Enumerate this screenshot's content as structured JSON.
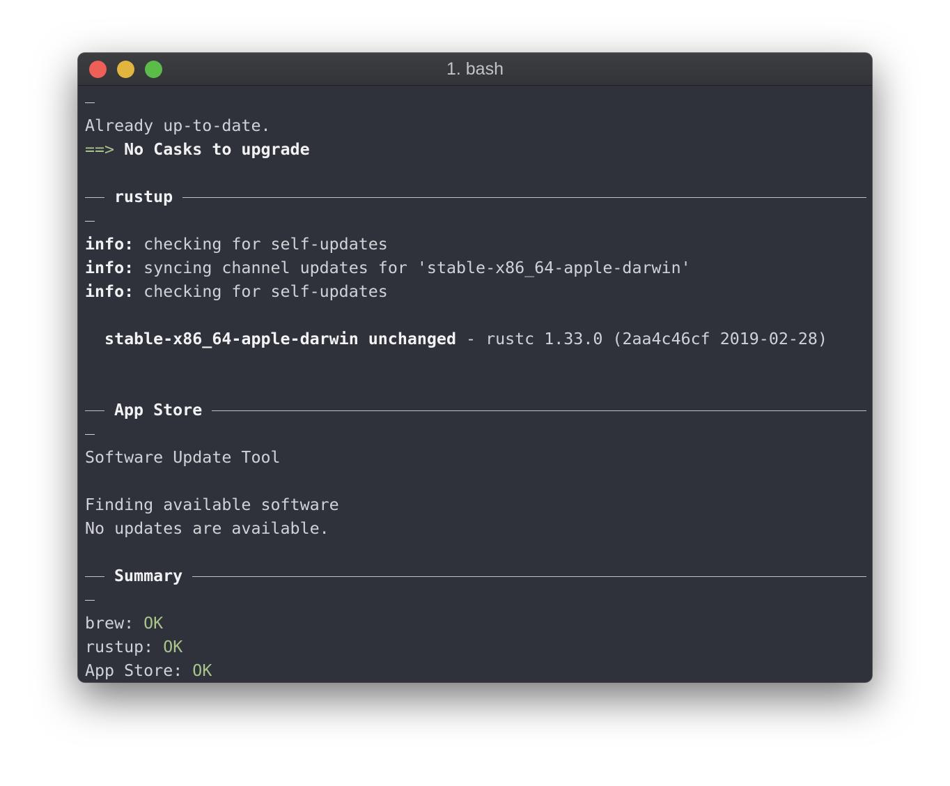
{
  "window": {
    "title": "1. bash"
  },
  "terminal": {
    "brew_tail": {
      "already": "Already up-to-date.",
      "arrow": "==>",
      "no_casks": "No Casks to upgrade"
    },
    "rustup": {
      "header": "rustup",
      "info_label": "info:",
      "info1": " checking for self-updates",
      "info2": " syncing channel updates for 'stable-x86_64-apple-darwin'",
      "info3": " checking for self-updates",
      "toolchain": "  stable-x86_64-apple-darwin unchanged",
      "toolchain_rest": " - rustc 1.33.0 (2aa4c46cf 2019-02-28)"
    },
    "appstore": {
      "header": "App Store",
      "tool": "Software Update Tool",
      "finding": "Finding available software",
      "no_updates": "No updates are available."
    },
    "summary": {
      "header": "Summary",
      "brew_label": "brew: ",
      "brew_status": "OK",
      "rustup_label": "rustup: ",
      "rustup_status": "OK",
      "appstore_label": "App Store: ",
      "appstore_status": "OK"
    }
  },
  "colors": {
    "background": "#2f323b",
    "ok_green": "#a9c48a",
    "close": "#ed5f57",
    "minimize": "#e2b63e",
    "zoom": "#5cbc4a"
  }
}
